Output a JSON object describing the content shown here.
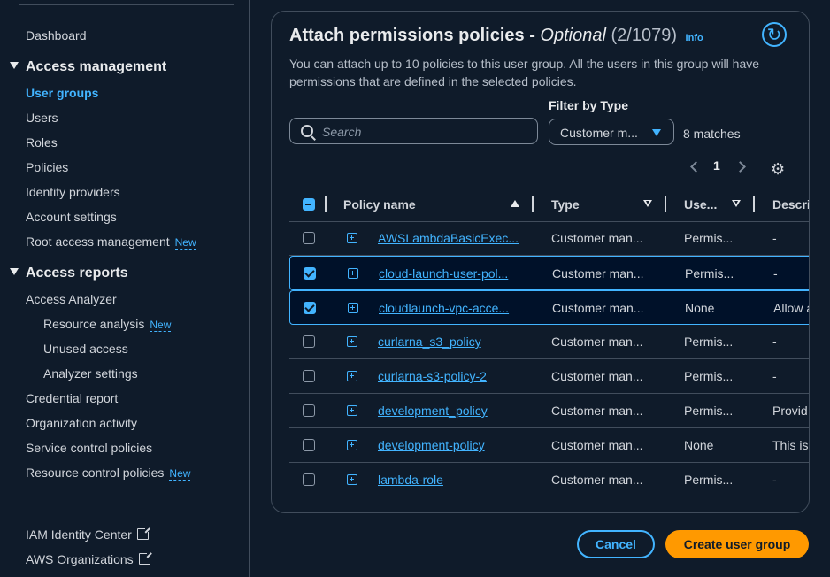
{
  "sidebar": {
    "dashboard": "Dashboard",
    "access_management": "Access management",
    "am_items": [
      "User groups",
      "Users",
      "Roles",
      "Policies",
      "Identity providers",
      "Account settings",
      "Root access management"
    ],
    "access_reports": "Access reports",
    "ar_items": [
      "Access Analyzer",
      "Resource analysis",
      "Unused access",
      "Analyzer settings",
      "Credential report",
      "Organization activity",
      "Service control policies",
      "Resource control policies"
    ],
    "new_badge": "New",
    "footer_items": [
      "IAM Identity Center",
      "AWS Organizations"
    ]
  },
  "panel": {
    "title": "Attach permissions policies - ",
    "title_optional": "Optional",
    "count": "(2/1079)",
    "info": "Info",
    "description": "You can attach up to 10 policies to this user group. All the users in this group will have permissions that are defined in the selected policies.",
    "search_placeholder": "Search",
    "filter_label": "Filter by Type",
    "filter_value": "Customer m...",
    "matches": "8 matches",
    "page": "1"
  },
  "table": {
    "headers": [
      "Policy name",
      "Type",
      "Use...",
      "Descri"
    ],
    "rows": [
      {
        "name": "AWSLambdaBasicExec...",
        "type": "Customer man...",
        "use": "Permis...",
        "desc": "-",
        "checked": false
      },
      {
        "name": "cloud-launch-user-pol...",
        "type": "Customer man...",
        "use": "Permis...",
        "desc": "-",
        "checked": true
      },
      {
        "name": "cloudlaunch-vpc-acce...",
        "type": "Customer man...",
        "use": "None",
        "desc": "Allow a",
        "checked": true
      },
      {
        "name": "curlarna_s3_policy",
        "type": "Customer man...",
        "use": "Permis...",
        "desc": "-",
        "checked": false
      },
      {
        "name": "curlarna-s3-policy-2",
        "type": "Customer man...",
        "use": "Permis...",
        "desc": "-",
        "checked": false
      },
      {
        "name": "development_policy",
        "type": "Customer man...",
        "use": "Permis...",
        "desc": "Provid",
        "checked": false
      },
      {
        "name": "development-policy",
        "type": "Customer man...",
        "use": "None",
        "desc": "This is",
        "checked": false
      },
      {
        "name": "lambda-role",
        "type": "Customer man...",
        "use": "Permis...",
        "desc": "-",
        "checked": false
      }
    ]
  },
  "actions": {
    "cancel": "Cancel",
    "create": "Create user group"
  },
  "colors": {
    "accent": "#42b4ff",
    "primary_button": "#ff9900",
    "background": "#0f1b2a"
  }
}
